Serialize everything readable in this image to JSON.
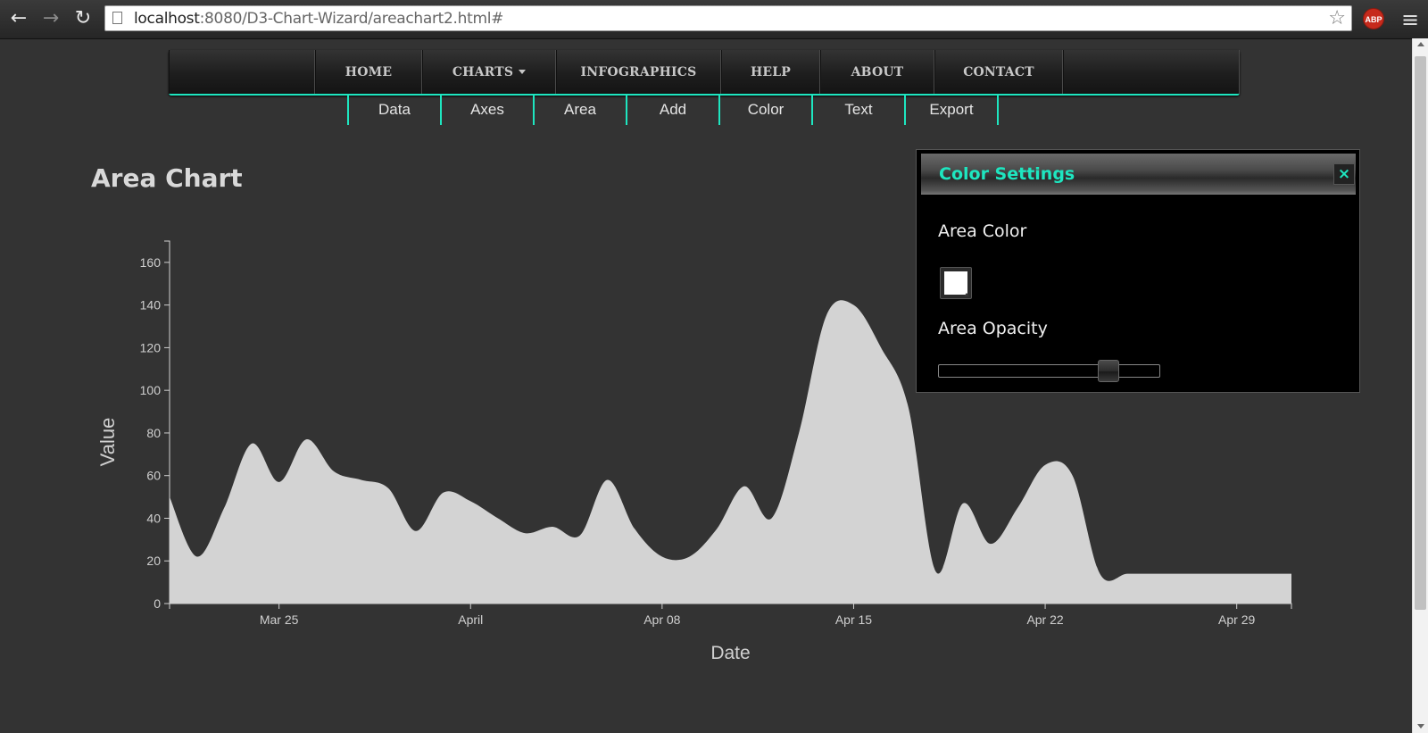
{
  "browser": {
    "url_host": "localhost",
    "url_rest": ":8080/D3-Chart-Wizard/areachart2.html#",
    "back_icon": "←",
    "forward_icon": "→",
    "reload_icon": "↻",
    "star_icon": "☆",
    "adblock_label": "ABP",
    "menu_icon": "≡"
  },
  "main_nav": {
    "items": [
      {
        "label": ""
      },
      {
        "label": "HOME"
      },
      {
        "label": "CHARTS"
      },
      {
        "label": "INFOGRAPHICS"
      },
      {
        "label": "HELP"
      },
      {
        "label": "ABOUT"
      },
      {
        "label": "CONTACT"
      },
      {
        "label": ""
      }
    ]
  },
  "sub_nav": {
    "items": [
      {
        "label": "Data"
      },
      {
        "label": "Axes"
      },
      {
        "label": "Area"
      },
      {
        "label": "Add"
      },
      {
        "label": "Color"
      },
      {
        "label": "Text"
      },
      {
        "label": "Export"
      }
    ]
  },
  "page": {
    "title": "Area Chart"
  },
  "chart_data": {
    "type": "area",
    "xlabel": "Date",
    "ylabel": "Value",
    "ylim": [
      0,
      170
    ],
    "yticks": [
      0,
      20,
      40,
      60,
      80,
      100,
      120,
      140,
      160
    ],
    "xticks": [
      {
        "label": "Mar 25",
        "day": 4
      },
      {
        "label": "April",
        "day": 11
      },
      {
        "label": "Apr 08",
        "day": 18
      },
      {
        "label": "Apr 15",
        "day": 25
      },
      {
        "label": "Apr 22",
        "day": 32
      },
      {
        "label": "Apr 29",
        "day": 39
      }
    ],
    "x": [
      0,
      1,
      2,
      3,
      4,
      5,
      6,
      7,
      8,
      9,
      10,
      11,
      12,
      13,
      14,
      15,
      16,
      17,
      18,
      19,
      20,
      21,
      22,
      23,
      24,
      25,
      26,
      27,
      28,
      29,
      30,
      31,
      32,
      33,
      34,
      35,
      36,
      37,
      38,
      39,
      40,
      41
    ],
    "values": [
      50,
      22,
      45,
      75,
      57,
      77,
      62,
      58,
      54,
      34,
      52,
      48,
      40,
      33,
      36,
      32,
      58,
      35,
      22,
      22,
      35,
      55,
      40,
      80,
      135,
      140,
      120,
      92,
      15,
      47,
      28,
      45,
      65,
      60,
      14,
      14,
      14,
      14,
      14,
      14,
      14,
      14
    ],
    "fill_color": "#d3d3d3",
    "area_opacity": 0.79
  },
  "color_panel": {
    "title": "Color Settings",
    "close_icon": "×",
    "area_color_label": "Area Color",
    "area_color_value": "#ffffff",
    "area_opacity_label": "Area Opacity",
    "area_opacity_value": 0.79
  },
  "colors": {
    "accent": "#1ee6c0",
    "background": "#333333"
  }
}
